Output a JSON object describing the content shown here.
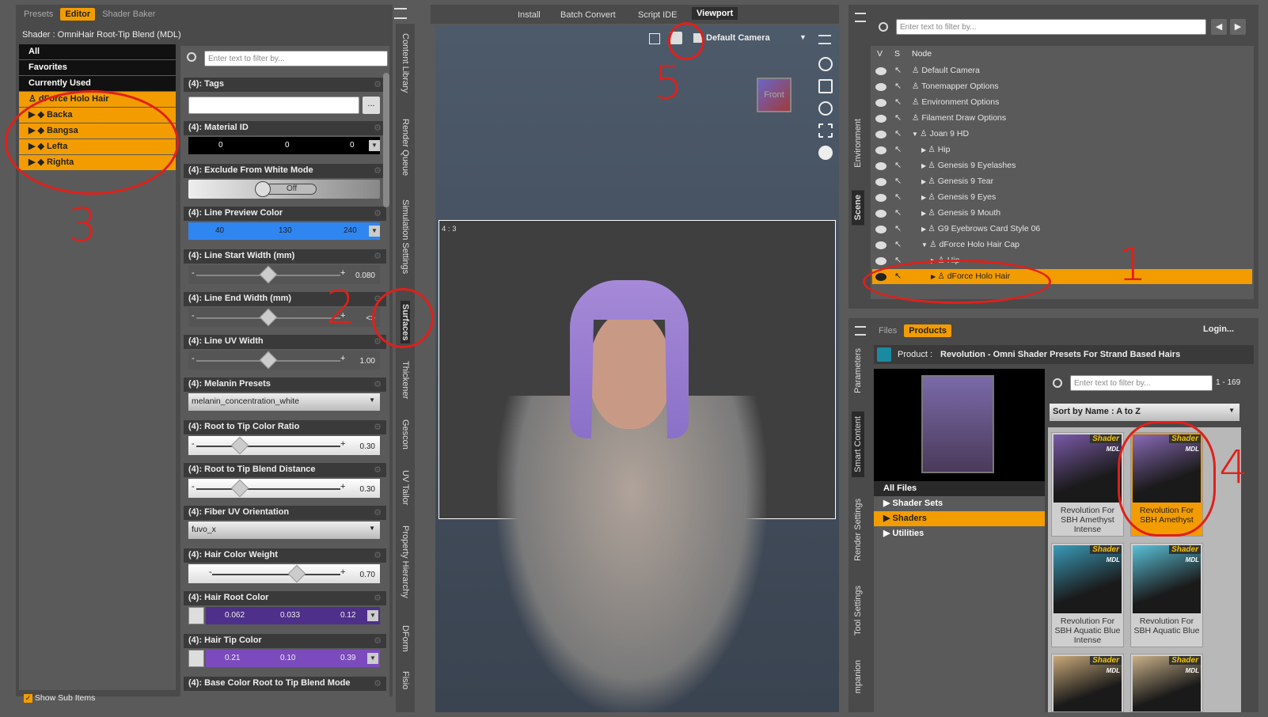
{
  "left_panel": {
    "tabs": [
      "Presets",
      "Editor",
      "Shader Baker"
    ],
    "active_tab": "Editor",
    "shader_label": "Shader : OmniHair Root-Tip Blend (MDL)",
    "categories": [
      "All",
      "Favorites",
      "Currently Used"
    ],
    "tree": {
      "root": "dForce Holo Hair",
      "children": [
        "Backa",
        "Bangsa",
        "Lefta",
        "Righta"
      ]
    },
    "show_sub_items": "Show Sub Items",
    "filter_placeholder": "Enter text to filter by...",
    "properties": {
      "tags": {
        "title": "(4): Tags",
        "button": "..."
      },
      "material_id": {
        "title": "(4): Material ID",
        "values": [
          "0",
          "0",
          "0"
        ]
      },
      "exclude_white": {
        "title": "(4): Exclude From White Mode",
        "value": "Off"
      },
      "line_preview": {
        "title": "(4): Line Preview Color",
        "values": [
          "40",
          "130",
          "240"
        ],
        "color": "#2f86f0"
      },
      "line_start": {
        "title": "(4): Line Start Width (mm)",
        "value": "0.080",
        "level": 0.5
      },
      "line_end": {
        "title": "(4): Line End Width (mm)",
        "value": "<>",
        "level": 0.5
      },
      "line_uv": {
        "title": "(4): Line UV Width",
        "value": "1.00",
        "level": 0.5
      },
      "melanin": {
        "title": "(4): Melanin Presets",
        "value": "melanin_concentration_white"
      },
      "root_tip_ratio": {
        "title": "(4): Root to Tip Color Ratio",
        "value": "0.30",
        "level": 0.3
      },
      "root_tip_blend": {
        "title": "(4): Root to Tip Blend Distance",
        "value": "0.30",
        "level": 0.3
      },
      "fiber_uv": {
        "title": "(4): Fiber UV Orientation",
        "value": "fuvo_x"
      },
      "hair_weight": {
        "title": "(4): Hair Color Weight",
        "value": "0.70",
        "level": 0.7
      },
      "hair_root": {
        "title": "(4): Hair Root Color",
        "values": [
          "0.062",
          "0.033",
          "0.12"
        ],
        "color": "#4e2f8a"
      },
      "hair_tip": {
        "title": "(4): Hair Tip Color",
        "values": [
          "0.21",
          "0.10",
          "0.39"
        ],
        "color": "#7b4bbd"
      },
      "base_color": {
        "title": "(4): Base Color Root to Tip Blend Mode"
      }
    }
  },
  "vertical_tabs_left": [
    "Content Library",
    "Render Queue",
    "Simulation Settings",
    "Surfaces",
    "Thickener",
    "Gescon",
    "UV Tailor",
    "Property Hierarchy",
    "DForm",
    "Fisio"
  ],
  "viewport": {
    "top_tabs": [
      "Install",
      "Batch Convert",
      "Script IDE",
      "Viewport"
    ],
    "active_tab": "Viewport",
    "camera": "Default Camera",
    "cube_label": "Front",
    "aspect": "4 : 3"
  },
  "scene": {
    "filter_placeholder": "Enter text to filter by...",
    "headers": [
      "V",
      "S",
      "Node"
    ],
    "rows": [
      {
        "label": "Default Camera",
        "indent": 0,
        "arrow": ""
      },
      {
        "label": "Tonemapper Options",
        "indent": 0,
        "arrow": ""
      },
      {
        "label": "Environment Options",
        "indent": 0,
        "arrow": ""
      },
      {
        "label": "Filament Draw Options",
        "indent": 0,
        "arrow": ""
      },
      {
        "label": "Joan 9 HD",
        "indent": 0,
        "arrow": "▼"
      },
      {
        "label": "Hip",
        "indent": 1,
        "arrow": "▶"
      },
      {
        "label": "Genesis 9 Eyelashes",
        "indent": 1,
        "arrow": "▶"
      },
      {
        "label": "Genesis 9 Tear",
        "indent": 1,
        "arrow": "▶"
      },
      {
        "label": "Genesis 9 Eyes",
        "indent": 1,
        "arrow": "▶"
      },
      {
        "label": "Genesis 9 Mouth",
        "indent": 1,
        "arrow": "▶"
      },
      {
        "label": "G9 Eyebrows Card Style 06",
        "indent": 1,
        "arrow": "▶"
      },
      {
        "label": "dForce Holo Hair Cap",
        "indent": 1,
        "arrow": "▼"
      },
      {
        "label": "Hip",
        "indent": 2,
        "arrow": "▶"
      },
      {
        "label": "dForce Holo Hair",
        "indent": 2,
        "arrow": "▶"
      }
    ],
    "selected": "dForce Holo Hair",
    "side_tabs": [
      "Environment",
      "Scene"
    ]
  },
  "content": {
    "tabs": [
      "Files",
      "Products"
    ],
    "active_tab": "Products",
    "login": "Login...",
    "product_label": "Product :",
    "product_name": "Revolution - Omni Shader Presets For Strand Based Hairs",
    "filter_placeholder": "Enter text to filter by...",
    "count": "1 - 169",
    "sort": "Sort by Name : A to Z",
    "categories": [
      "All Files",
      "Shader Sets",
      "Shaders",
      "Utilities"
    ],
    "selected_category": "Shaders",
    "badge": "Shader",
    "badge_sub": "MDL",
    "tiles": [
      {
        "caption": "Revolution For SBH Amethyst Intense",
        "selected": false,
        "hair": "#7a5aa8"
      },
      {
        "caption": "Revolution For SBH Amethyst",
        "selected": true,
        "hair": "#8a6ab8"
      },
      {
        "caption": "Revolution For SBH Aquatic Blue Intense",
        "selected": false,
        "hair": "#3a9ab8"
      },
      {
        "caption": "Revolution For SBH Aquatic Blue",
        "selected": false,
        "hair": "#5ac0d8"
      },
      {
        "caption": "",
        "selected": false,
        "hair": "#c8a878"
      },
      {
        "caption": "",
        "selected": false,
        "hair": "#c8b088"
      }
    ],
    "side_tabs": [
      "Parameters",
      "Smart Content",
      "Render Settings",
      "Tool Settings",
      "mpanion"
    ]
  },
  "annotations": [
    "1",
    "2",
    "3",
    "4",
    "5"
  ],
  "colors": {
    "accent": "#f39c00",
    "annotation": "#e0201a"
  }
}
